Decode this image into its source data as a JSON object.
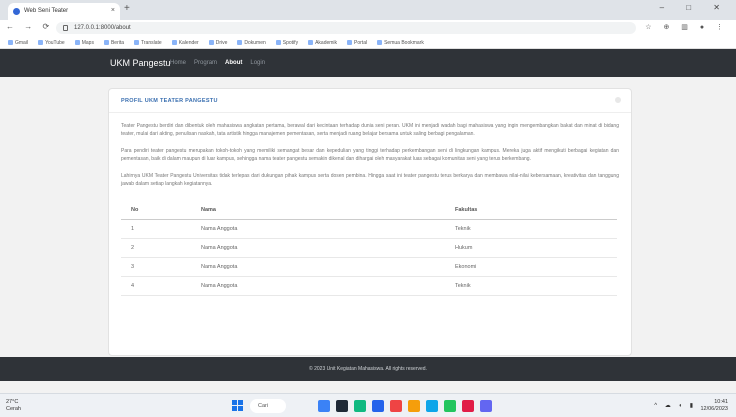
{
  "browser": {
    "tab_title": "Web Seni Teater",
    "tab_close": "×",
    "new_tab": "+",
    "window_controls": "–  □  ✕",
    "nav_buttons": "←  →  ⟳",
    "url": "127.0.0.1:8000/about",
    "right_icons": "☆ ⊕ ▥ ●  ⋮",
    "bookmarks": [
      "Gmail",
      "YouTube",
      "Maps",
      "Berita",
      "Translate",
      "Kalender",
      "Drive",
      "Dokumen",
      "Spotify",
      "Akademik",
      "Portal",
      "Semua Bookmark"
    ]
  },
  "navbar": {
    "brand": "UKM Pangestu",
    "links": [
      {
        "label": "Home",
        "active": false
      },
      {
        "label": "Program",
        "active": false
      },
      {
        "label": "About",
        "active": true
      },
      {
        "label": "Login",
        "active": false
      }
    ]
  },
  "card": {
    "title": "PROFIL UKM TEATER PANGESTU",
    "paragraphs": [
      "Teater Pangestu berdiri dan dibentuk oleh mahasiswa angkatan pertama, berawal dari kecintaan terhadap dunia seni peran. UKM ini menjadi wadah bagi mahasiswa yang ingin mengembangkan bakat dan minat di bidang teater, mulai dari akting, penulisan naskah, tata artistik hingga manajemen pementasan, serta menjadi ruang belajar bersama untuk saling berbagi pengalaman.",
      "Para pendiri teater pangestu merupakan tokoh-tokoh yang memiliki semangat besar dan kepedulian yang tinggi terhadap perkembangan seni di lingkungan kampus. Mereka juga aktif mengikuti berbagai kegiatan dan pementasan, baik di dalam maupun di luar kampus, sehingga nama teater pangestu semakin dikenal dan dihargai oleh masyarakat luas sebagai komunitas seni yang terus berkembang.",
      "Lahirnya UKM Teater Pangestu Universitas tidak terlepas dari dukungan pihak kampus serta dosen pembina. Hingga saat ini teater pangestu terus berkarya dan membawa nilai-nilai kebersamaan, kreativitas dan tanggung jawab dalam setiap langkah kegiatannya."
    ]
  },
  "table": {
    "headers": [
      "No",
      "Nama",
      "Fakultas"
    ],
    "rows": [
      [
        "1",
        "Nama Anggota",
        "Teknik"
      ],
      [
        "2",
        "Nama Anggota",
        "Hukum"
      ],
      [
        "3",
        "Nama Anggota",
        "Ekonomi"
      ],
      [
        "4",
        "Nama Anggota",
        "Teknik"
      ]
    ]
  },
  "footer": {
    "text": "© 2023 Unit Kegiatan Mahasiswa. All rights reserved."
  },
  "taskbar": {
    "weather_temp": "27°C",
    "weather_desc": "Cerah",
    "search_label": "Cari",
    "tray": "^ ☁ ◖ ▮",
    "time": "10:41",
    "date": "12/06/2023",
    "app_colors": [
      "#3b82f6",
      "#1f2937",
      "#10b981",
      "#2563eb",
      "#ef4444",
      "#f59e0b",
      "#0ea5e9",
      "#22c55e",
      "#e11d48",
      "#6366f1"
    ]
  },
  "colors": {
    "navbar_bg": "#2f3338",
    "card_title": "#3a6fb0",
    "page_bg": "#f2f2f2"
  }
}
